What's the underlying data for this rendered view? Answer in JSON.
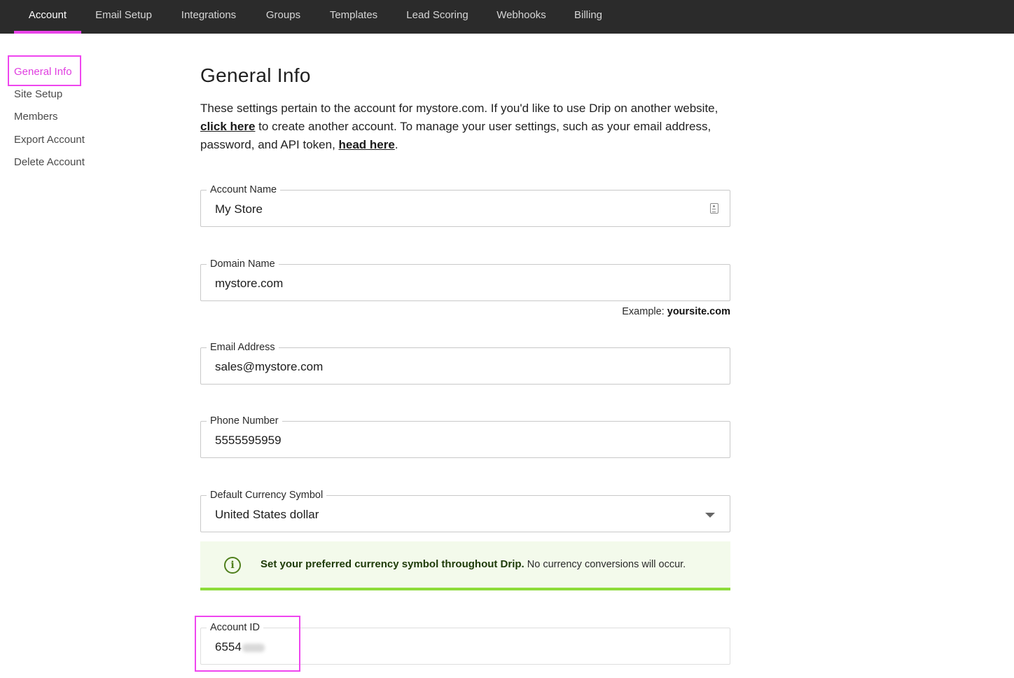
{
  "topnav": {
    "tabs": [
      {
        "label": "Account",
        "active": true
      },
      {
        "label": "Email Setup",
        "active": false
      },
      {
        "label": "Integrations",
        "active": false
      },
      {
        "label": "Groups",
        "active": false
      },
      {
        "label": "Templates",
        "active": false
      },
      {
        "label": "Lead Scoring",
        "active": false
      },
      {
        "label": "Webhooks",
        "active": false
      },
      {
        "label": "Billing",
        "active": false
      }
    ]
  },
  "sidebar": {
    "items": [
      {
        "label": "General Info",
        "active": true
      },
      {
        "label": "Site Setup",
        "active": false
      },
      {
        "label": "Members",
        "active": false
      },
      {
        "label": "Export Account",
        "active": false
      },
      {
        "label": "Delete Account",
        "active": false
      }
    ]
  },
  "main": {
    "title": "General Info",
    "intro": {
      "part1": "These settings pertain to the account for mystore.com. If you'd like to use Drip on another website, ",
      "link1": "click here",
      "part2": " to create another account. To manage your user settings, such as your email address, password, and API token, ",
      "link2": "head here",
      "part3": "."
    },
    "fields": {
      "account_name": {
        "label": "Account Name",
        "value": "My Store",
        "icon": "contact-card-icon"
      },
      "domain_name": {
        "label": "Domain Name",
        "value": "mystore.com",
        "hint_prefix": "Example:",
        "hint_value": "yoursite.com"
      },
      "email_address": {
        "label": "Email Address",
        "value": "sales@mystore.com"
      },
      "phone_number": {
        "label": "Phone Number",
        "value": "5555595959"
      },
      "currency": {
        "label": "Default Currency Symbol",
        "value": "United States dollar",
        "icon": "chevron-down-icon"
      },
      "account_id": {
        "label": "Account ID",
        "value": "6554"
      }
    },
    "notice": {
      "icon": "info-icon",
      "bold": "Set your preferred currency symbol throughout Drip.",
      "text": " No currency conversions will occur."
    }
  },
  "colors": {
    "nav_bg": "#2b2b2b",
    "accent": "#e843e8",
    "notice_bg": "#f3faeb",
    "notice_border": "#8ddc3a",
    "info_icon": "#4f7f1c"
  }
}
